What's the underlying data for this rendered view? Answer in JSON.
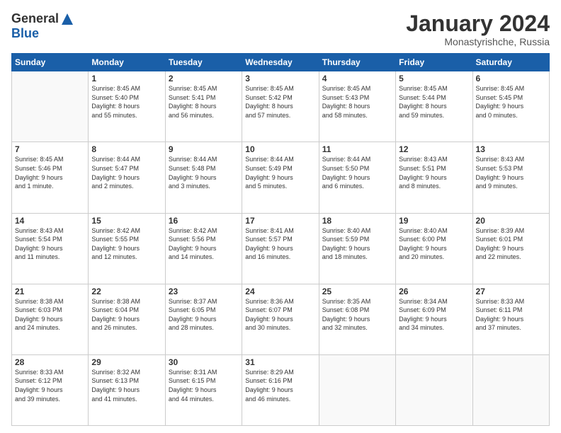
{
  "logo": {
    "general": "General",
    "blue": "Blue"
  },
  "title": "January 2024",
  "location": "Monastyrishche, Russia",
  "weekdays": [
    "Sunday",
    "Monday",
    "Tuesday",
    "Wednesday",
    "Thursday",
    "Friday",
    "Saturday"
  ],
  "weeks": [
    [
      {
        "day": "",
        "info": ""
      },
      {
        "day": "1",
        "info": "Sunrise: 8:45 AM\nSunset: 5:40 PM\nDaylight: 8 hours\nand 55 minutes."
      },
      {
        "day": "2",
        "info": "Sunrise: 8:45 AM\nSunset: 5:41 PM\nDaylight: 8 hours\nand 56 minutes."
      },
      {
        "day": "3",
        "info": "Sunrise: 8:45 AM\nSunset: 5:42 PM\nDaylight: 8 hours\nand 57 minutes."
      },
      {
        "day": "4",
        "info": "Sunrise: 8:45 AM\nSunset: 5:43 PM\nDaylight: 8 hours\nand 58 minutes."
      },
      {
        "day": "5",
        "info": "Sunrise: 8:45 AM\nSunset: 5:44 PM\nDaylight: 8 hours\nand 59 minutes."
      },
      {
        "day": "6",
        "info": "Sunrise: 8:45 AM\nSunset: 5:45 PM\nDaylight: 9 hours\nand 0 minutes."
      }
    ],
    [
      {
        "day": "7",
        "info": "Sunrise: 8:45 AM\nSunset: 5:46 PM\nDaylight: 9 hours\nand 1 minute."
      },
      {
        "day": "8",
        "info": "Sunrise: 8:44 AM\nSunset: 5:47 PM\nDaylight: 9 hours\nand 2 minutes."
      },
      {
        "day": "9",
        "info": "Sunrise: 8:44 AM\nSunset: 5:48 PM\nDaylight: 9 hours\nand 3 minutes."
      },
      {
        "day": "10",
        "info": "Sunrise: 8:44 AM\nSunset: 5:49 PM\nDaylight: 9 hours\nand 5 minutes."
      },
      {
        "day": "11",
        "info": "Sunrise: 8:44 AM\nSunset: 5:50 PM\nDaylight: 9 hours\nand 6 minutes."
      },
      {
        "day": "12",
        "info": "Sunrise: 8:43 AM\nSunset: 5:51 PM\nDaylight: 9 hours\nand 8 minutes."
      },
      {
        "day": "13",
        "info": "Sunrise: 8:43 AM\nSunset: 5:53 PM\nDaylight: 9 hours\nand 9 minutes."
      }
    ],
    [
      {
        "day": "14",
        "info": "Sunrise: 8:43 AM\nSunset: 5:54 PM\nDaylight: 9 hours\nand 11 minutes."
      },
      {
        "day": "15",
        "info": "Sunrise: 8:42 AM\nSunset: 5:55 PM\nDaylight: 9 hours\nand 12 minutes."
      },
      {
        "day": "16",
        "info": "Sunrise: 8:42 AM\nSunset: 5:56 PM\nDaylight: 9 hours\nand 14 minutes."
      },
      {
        "day": "17",
        "info": "Sunrise: 8:41 AM\nSunset: 5:57 PM\nDaylight: 9 hours\nand 16 minutes."
      },
      {
        "day": "18",
        "info": "Sunrise: 8:40 AM\nSunset: 5:59 PM\nDaylight: 9 hours\nand 18 minutes."
      },
      {
        "day": "19",
        "info": "Sunrise: 8:40 AM\nSunset: 6:00 PM\nDaylight: 9 hours\nand 20 minutes."
      },
      {
        "day": "20",
        "info": "Sunrise: 8:39 AM\nSunset: 6:01 PM\nDaylight: 9 hours\nand 22 minutes."
      }
    ],
    [
      {
        "day": "21",
        "info": "Sunrise: 8:38 AM\nSunset: 6:03 PM\nDaylight: 9 hours\nand 24 minutes."
      },
      {
        "day": "22",
        "info": "Sunrise: 8:38 AM\nSunset: 6:04 PM\nDaylight: 9 hours\nand 26 minutes."
      },
      {
        "day": "23",
        "info": "Sunrise: 8:37 AM\nSunset: 6:05 PM\nDaylight: 9 hours\nand 28 minutes."
      },
      {
        "day": "24",
        "info": "Sunrise: 8:36 AM\nSunset: 6:07 PM\nDaylight: 9 hours\nand 30 minutes."
      },
      {
        "day": "25",
        "info": "Sunrise: 8:35 AM\nSunset: 6:08 PM\nDaylight: 9 hours\nand 32 minutes."
      },
      {
        "day": "26",
        "info": "Sunrise: 8:34 AM\nSunset: 6:09 PM\nDaylight: 9 hours\nand 34 minutes."
      },
      {
        "day": "27",
        "info": "Sunrise: 8:33 AM\nSunset: 6:11 PM\nDaylight: 9 hours\nand 37 minutes."
      }
    ],
    [
      {
        "day": "28",
        "info": "Sunrise: 8:33 AM\nSunset: 6:12 PM\nDaylight: 9 hours\nand 39 minutes."
      },
      {
        "day": "29",
        "info": "Sunrise: 8:32 AM\nSunset: 6:13 PM\nDaylight: 9 hours\nand 41 minutes."
      },
      {
        "day": "30",
        "info": "Sunrise: 8:31 AM\nSunset: 6:15 PM\nDaylight: 9 hours\nand 44 minutes."
      },
      {
        "day": "31",
        "info": "Sunrise: 8:29 AM\nSunset: 6:16 PM\nDaylight: 9 hours\nand 46 minutes."
      },
      {
        "day": "",
        "info": ""
      },
      {
        "day": "",
        "info": ""
      },
      {
        "day": "",
        "info": ""
      }
    ]
  ]
}
